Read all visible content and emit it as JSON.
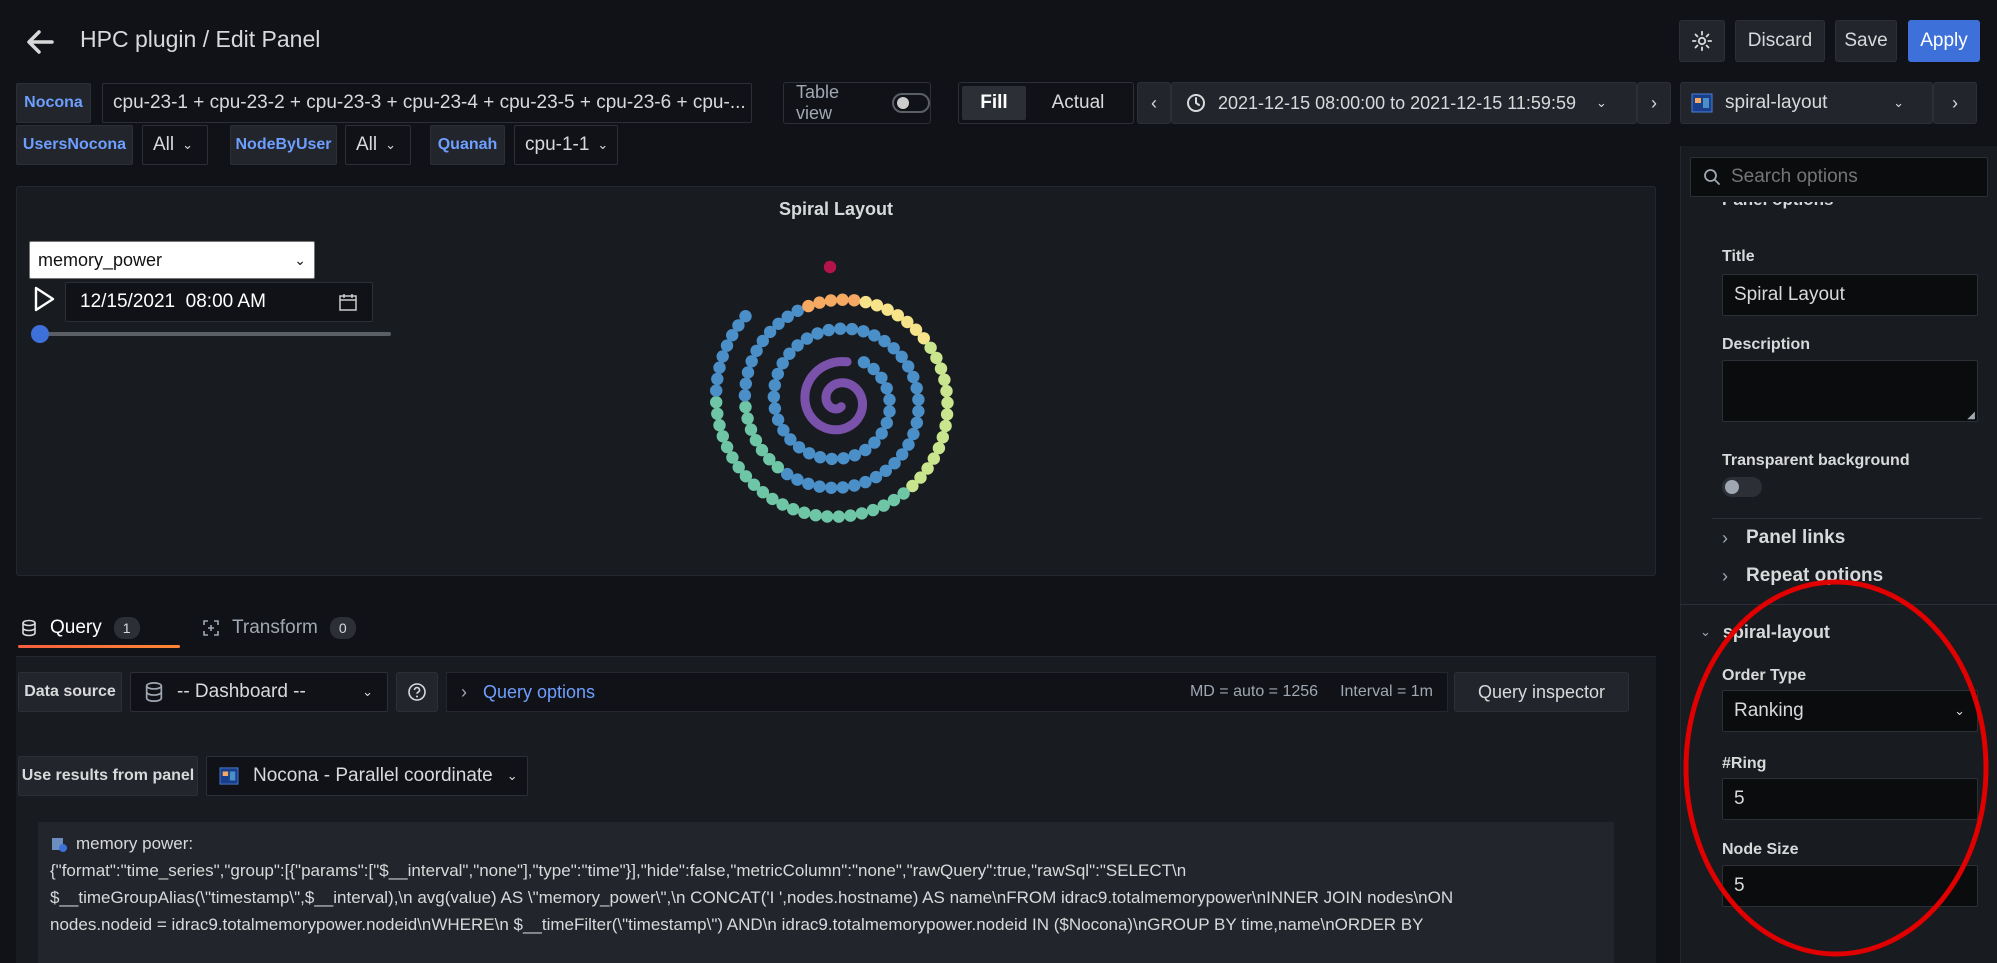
{
  "header": {
    "title": "HPC plugin / Edit Panel",
    "discard": "Discard",
    "save": "Save",
    "apply": "Apply"
  },
  "variables": {
    "nocona_label": "Nocona",
    "nocona_value": "cpu-23-1 + cpu-23-2 + cpu-23-3 + cpu-23-4 + cpu-23-5 + cpu-23-6 + cpu-...",
    "usersnocona_label": "UsersNocona",
    "usersnocona_value": "All",
    "nodebyuser_label": "NodeByUser",
    "nodebyuser_value": "All",
    "quanah_label": "Quanah",
    "quanah_value": "cpu-1-1"
  },
  "toolbar": {
    "table_view": "Table view",
    "fill": "Fill",
    "actual": "Actual",
    "time_range": "2021-12-15 08:00:00 to 2021-12-15 11:59:59",
    "viz": "spiral-layout"
  },
  "preview": {
    "title": "Spiral Layout",
    "metric": "memory_power",
    "date": "12/15/2021  08:00 AM",
    "slider_value": 0,
    "spiral_colors": [
      "#7b52ab",
      "#4b8fc9",
      "#6fc6a6",
      "#c9e58d",
      "#f7e38a",
      "#f5a962",
      "#b5144a"
    ]
  },
  "query": {
    "tab_query": "Query",
    "tab_query_count": "1",
    "tab_transform": "Transform",
    "tab_transform_count": "0",
    "data_source_label": "Data source",
    "data_source_value": "-- Dashboard --",
    "query_options": "Query options",
    "md": "MD = auto = 1256",
    "interval": "Interval = 1m",
    "inspector": "Query inspector",
    "use_results_label": "Use results from panel",
    "use_results_value": "Nocona - Parallel coordinate",
    "code_name": "memory power:",
    "code_line1": "{\"format\":\"time_series\",\"group\":[{\"params\":[\"$__interval\",\"none\"],\"type\":\"time\"}],\"hide\":false,\"metricColumn\":\"none\",\"rawQuery\":true,\"rawSql\":\"SELECT\\n",
    "code_line2": "$__timeGroupAlias(\\\"timestamp\\\",$__interval),\\n avg(value) AS \\\"memory_power\\\",\\n CONCAT('I ',nodes.hostname) AS name\\nFROM idrac9.totalmemorypower\\nINNER JOIN nodes\\nON",
    "code_line3": "nodes.nodeid = idrac9.totalmemorypower.nodeid\\nWHERE\\n $__timeFilter(\\\"timestamp\\\") AND\\n idrac9.totalmemorypower.nodeid IN ($Nocona)\\nGROUP BY time,name\\nORDER BY"
  },
  "options": {
    "search_placeholder": "Search options",
    "panel_options_cut": "Panel options",
    "title_label": "Title",
    "title_value": "Spiral Layout",
    "description_label": "Description",
    "transparent_label": "Transparent background",
    "panel_links": "Panel links",
    "repeat_options": "Repeat options",
    "plugin_section": "spiral-layout",
    "order_type_label": "Order Type",
    "order_type_value": "Ranking",
    "ring_label": "#Ring",
    "ring_value": "5",
    "node_size_label": "Node Size",
    "node_size_value": "5"
  },
  "colors": {
    "accent": "#3d71d9",
    "link": "#6e9fff",
    "annotation": "#e00000",
    "tab_underline": "#f55f3e"
  }
}
